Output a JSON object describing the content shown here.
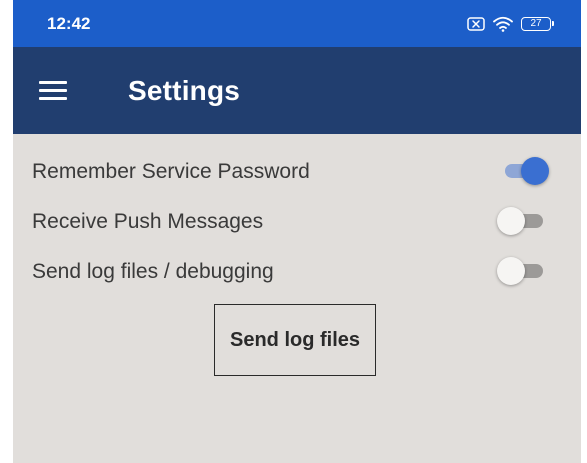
{
  "status_bar": {
    "time": "12:42",
    "battery_level": "27",
    "icons": [
      "notification-x-icon",
      "wifi-icon",
      "battery-icon"
    ]
  },
  "app_bar": {
    "title": "Settings",
    "menu_icon": "hamburger-menu-icon"
  },
  "settings": [
    {
      "label": "Remember Service Password",
      "enabled": true
    },
    {
      "label": "Receive Push Messages",
      "enabled": false
    },
    {
      "label": "Send log files / debugging",
      "enabled": false
    }
  ],
  "send_log_button": {
    "label": "Send log files"
  },
  "colors": {
    "status_bar": "#1c5ec9",
    "app_bar": "#213e6f",
    "background": "#e1dedb",
    "toggle_on_thumb": "#3a6fd1",
    "toggle_on_track": "#8ea6d6",
    "toggle_off_thumb": "#f6f5f3",
    "toggle_off_track": "#9c9a98"
  }
}
